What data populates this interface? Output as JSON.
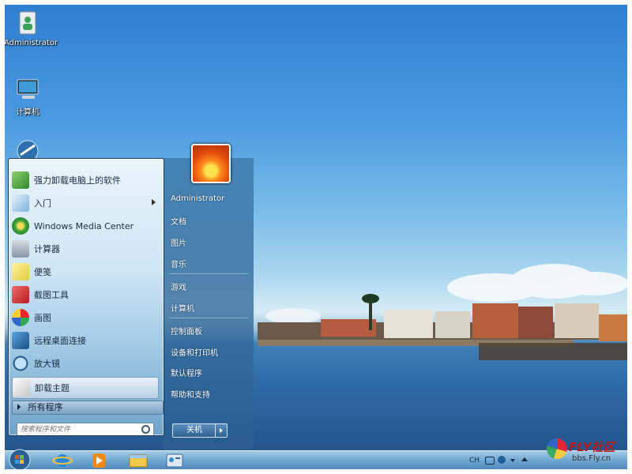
{
  "desktop": {
    "icons": [
      {
        "label": "Administrator",
        "icon": "user-folder-icon"
      },
      {
        "label": "计算机",
        "icon": "computer-icon"
      },
      {
        "label": "",
        "icon": "network-globe-icon"
      }
    ]
  },
  "start_menu": {
    "programs": [
      {
        "label": "强力卸载电脑上的软件",
        "icon": "uninstall-software-icon"
      },
      {
        "label": "入门",
        "icon": "getting-started-icon",
        "has_submenu": true
      },
      {
        "label": "Windows Media Center",
        "icon": "media-center-icon"
      },
      {
        "label": "计算器",
        "icon": "calculator-icon"
      },
      {
        "label": "便笺",
        "icon": "sticky-notes-icon"
      },
      {
        "label": "截图工具",
        "icon": "snipping-tool-icon"
      },
      {
        "label": "画图",
        "icon": "paint-icon"
      },
      {
        "label": "远程桌面连接",
        "icon": "remote-desktop-icon"
      },
      {
        "label": "放大镜",
        "icon": "magnifier-icon"
      },
      {
        "label": "卸载主题",
        "icon": "uninstall-theme-icon",
        "highlighted": true
      }
    ],
    "all_programs": "所有程序",
    "search_placeholder": "搜索程序和文件",
    "right_links": [
      "Administrator",
      "文档",
      "图片",
      "音乐",
      "游戏",
      "计算机",
      "控制面板",
      "设备和打印机",
      "默认程序",
      "帮助和支持"
    ],
    "shutdown_label": "关机"
  },
  "taskbar": {
    "pinned": [
      "start-orb-icon",
      "internet-explorer-icon",
      "media-player-icon",
      "file-explorer-icon",
      "control-panel-icon"
    ],
    "tray": {
      "language": "CH"
    }
  },
  "watermark": {
    "text": "FLY社区",
    "url": "bbs.Fly.cn"
  }
}
